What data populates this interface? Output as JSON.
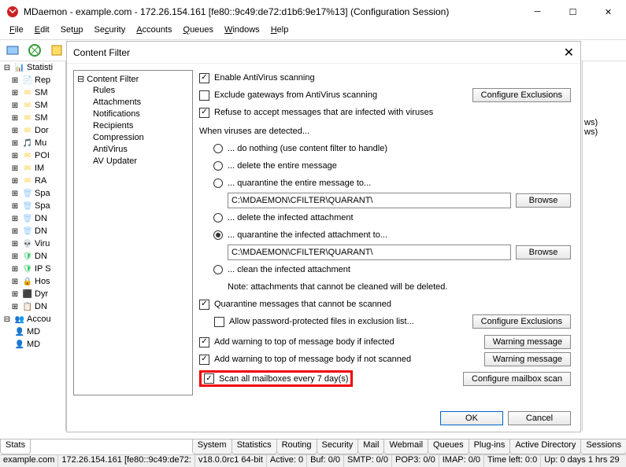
{
  "window": {
    "title": "MDaemon - example.com - 172.26.154.161 [fe80::9c49:de72:d1b6:9e17%13] (Configuration Session)"
  },
  "menu": [
    "File",
    "Edit",
    "Setup",
    "Security",
    "Accounts",
    "Queues",
    "Windows",
    "Help"
  ],
  "left_tree": {
    "root": "Statisti",
    "items": [
      "Rep",
      "SM",
      "SM",
      "SM",
      "Dor",
      "Mu",
      "POI",
      "IM",
      "RA",
      "Spa",
      "Spa",
      "DN",
      "DN",
      "Viru",
      "DN",
      "IP S",
      "Hos",
      "Dyr",
      "DN"
    ],
    "accounts_root": "Accou",
    "accounts": [
      "MD",
      "MD"
    ]
  },
  "right_items": [
    "ws)",
    "ws)"
  ],
  "dialog": {
    "title": "Content Filter",
    "tree_root": "Content Filter",
    "tree": [
      "Rules",
      "Attachments",
      "Notifications",
      "Recipients",
      "Compression",
      "AntiVirus",
      "AV Updater"
    ],
    "enable_av": "Enable AntiVirus scanning",
    "exclude_gw": "Exclude gateways from AntiVirus scanning",
    "cfg_excl": "Configure Exclusions",
    "refuse": "Refuse to accept messages that are infected with viruses",
    "when_detected": "When viruses are detected...",
    "r_nothing": "... do nothing (use content filter to handle)",
    "r_delete_msg": "... delete the entire message",
    "r_quar_msg": "... quarantine the entire message to...",
    "path1": "C:\\MDAEMON\\CFILTER\\QUARANT\\",
    "browse": "Browse",
    "r_delete_att": "... delete the infected attachment",
    "r_quar_att": "... quarantine the infected attachment to...",
    "path2": "C:\\MDAEMON\\CFILTER\\QUARANT\\",
    "r_clean": "... clean the infected attachment",
    "note": "Note: attachments that cannot be cleaned will be deleted.",
    "quar_unscanned": "Quarantine messages that cannot be scanned",
    "allow_pw": "Allow password-protected files in exclusion list...",
    "cfg_excl2": "Configure Exclusions",
    "warn_infected": "Add warning to top of message body if infected",
    "warn_btn1": "Warning message",
    "warn_notscan": "Add warning to top of message body if not scanned",
    "warn_btn2": "Warning message",
    "scan_mbx": "Scan all mailboxes every 7 day(s)",
    "cfg_mbx": "Configure mailbox scan",
    "ok": "OK",
    "cancel": "Cancel"
  },
  "bottom_left_tab": "Stats",
  "bottom_tabs": [
    "System",
    "Statistics",
    "Routing",
    "Security",
    "Mail",
    "Webmail",
    "Queues",
    "Plug-ins",
    "Active Directory",
    "Sessions"
  ],
  "status": {
    "host": "example.com",
    "ip": "172.26.154.161 [fe80::9c49:de72:",
    "ver": "v18.0.0rc1 64-bit",
    "active": "Active: 0",
    "buf": "Buf: 0/0",
    "smtp": "SMTP: 0/0",
    "pop3": "POP3: 0/0",
    "imap": "IMAP: 0/0",
    "time": "Time left: 0:0",
    "up": "Up: 0 days 1 hrs 29"
  }
}
